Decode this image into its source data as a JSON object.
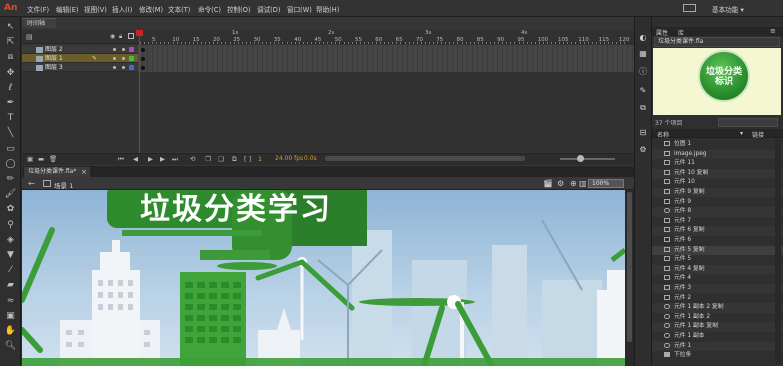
{
  "app": {
    "logo": "An"
  },
  "menu": {
    "items": [
      "文件(F)",
      "编辑(E)",
      "视图(V)",
      "插入(I)",
      "修改(M)",
      "文本(T)",
      "命令(C)",
      "控制(O)",
      "调试(D)",
      "窗口(W)",
      "帮助(H)"
    ],
    "workspace": "基本功能 ▾"
  },
  "timeline": {
    "tab_label": "时间轴",
    "seconds": [
      "1s",
      "2s",
      "3s",
      "4s"
    ],
    "frames": [
      "5",
      "10",
      "15",
      "20",
      "25",
      "30",
      "35",
      "40",
      "45",
      "50",
      "55",
      "60",
      "65",
      "70",
      "75",
      "80",
      "85",
      "90",
      "95",
      "100",
      "105",
      "110",
      "115",
      "120"
    ],
    "layers": [
      {
        "name": "图层 2",
        "selected": false
      },
      {
        "name": "图层 1",
        "selected": true
      },
      {
        "name": "图层 3",
        "selected": false
      }
    ],
    "current_frame": "1",
    "fps": "24.00 fps",
    "time": "0.0s"
  },
  "document": {
    "tab": "垃圾分类课件.fla*",
    "tab_close": "×",
    "scene": "场景 1",
    "zoom": "100%"
  },
  "stage": {
    "banner_text": "垃圾分类学习"
  },
  "library": {
    "tabs": [
      "属性",
      "库"
    ],
    "file": "垃圾分类课件.fla",
    "preview_text": [
      "垃圾分类",
      "标识"
    ],
    "count": "37 个项目",
    "column_name": "名称",
    "column_link": "链接",
    "items": [
      {
        "label": "位图 1",
        "type": "bitmap"
      },
      {
        "label": "image.jpeg",
        "type": "bitmap"
      },
      {
        "label": "元件 11",
        "type": "graphic"
      },
      {
        "label": "元件 10 复制",
        "type": "graphic"
      },
      {
        "label": "元件 10",
        "type": "graphic"
      },
      {
        "label": "元件 9 复制",
        "type": "graphic"
      },
      {
        "label": "元件 9",
        "type": "graphic"
      },
      {
        "label": "元件 8",
        "type": "button"
      },
      {
        "label": "元件 7",
        "type": "graphic"
      },
      {
        "label": "元件 6 复制",
        "type": "graphic"
      },
      {
        "label": "元件 6",
        "type": "graphic"
      },
      {
        "label": "元件 5 复制",
        "type": "graphic"
      },
      {
        "label": "元件 5",
        "type": "graphic"
      },
      {
        "label": "元件 4 复制",
        "type": "graphic"
      },
      {
        "label": "元件 4",
        "type": "graphic"
      },
      {
        "label": "元件 3",
        "type": "graphic"
      },
      {
        "label": "元件 2",
        "type": "graphic"
      },
      {
        "label": "元件 1 副本 2 复制",
        "type": "button"
      },
      {
        "label": "元件 1 副本 2",
        "type": "button"
      },
      {
        "label": "元件 1 副本 复制",
        "type": "button"
      },
      {
        "label": "元件 1 副本",
        "type": "button"
      },
      {
        "label": "元件 1",
        "type": "button"
      },
      {
        "label": "下拉条",
        "type": "folder"
      }
    ]
  }
}
